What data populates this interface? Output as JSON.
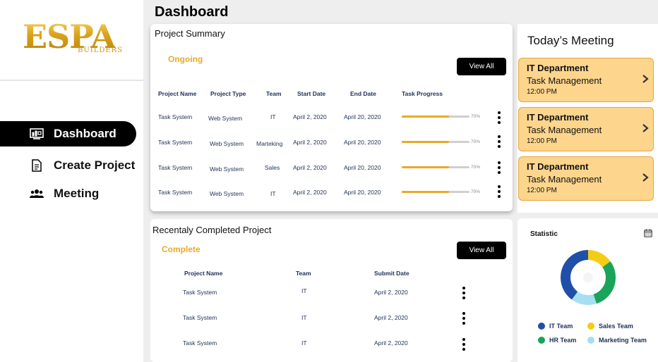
{
  "logo": {
    "main": "ESPA",
    "sub": "BUILDERS"
  },
  "nav": [
    {
      "label": "Dashboard",
      "active": true,
      "icon": "dashboard-icon"
    },
    {
      "label": "Create Project",
      "active": false,
      "icon": "document-icon"
    },
    {
      "label": "Meeting",
      "active": false,
      "icon": "people-icon"
    }
  ],
  "header": {
    "title": "Dashboard"
  },
  "summary": {
    "title": "Project Summary",
    "status": "Ongoing",
    "view_all": "View All",
    "columns": [
      "Project Name",
      "Project Type",
      "Team",
      "Start Date",
      "End Date",
      "Task Progress"
    ],
    "rows": [
      {
        "name": "Task System",
        "type": "Web System",
        "team": "IT",
        "start": "April 2, 2020",
        "end": "April 20, 2020",
        "progress": 0.7,
        "progress_label": "70%"
      },
      {
        "name": "Task System",
        "type": "Web System",
        "team": "Marteking",
        "start": "April 2, 2020",
        "end": "April 20, 2020",
        "progress": 0.7,
        "progress_label": "70%"
      },
      {
        "name": "Task System",
        "type": "Web System",
        "team": "Sales",
        "start": "April 2, 2020",
        "end": "April 20, 2020",
        "progress": 0.7,
        "progress_label": "70%"
      },
      {
        "name": "Task System",
        "type": "Web System",
        "team": "IT",
        "start": "April 2, 2020",
        "end": "April 20, 2020",
        "progress": 0.7,
        "progress_label": "70%"
      }
    ]
  },
  "completed": {
    "title": "Recentaly Completed Project",
    "status": "Complete",
    "view_all": "View All",
    "columns": [
      "Project Name",
      "Team",
      "Submit Date"
    ],
    "rows": [
      {
        "name": "Task System",
        "team": "IT",
        "date": "April 2, 2020"
      },
      {
        "name": "Task System",
        "team": "IT",
        "date": "April 2, 2020"
      },
      {
        "name": "Task System",
        "team": "IT",
        "date": "April 2, 2020"
      }
    ]
  },
  "meetings": {
    "title": "Today’s Meeting",
    "items": [
      {
        "dept": "IT Department",
        "task": "Task Management",
        "time": "12:00 PM"
      },
      {
        "dept": "IT Department",
        "task": "Task Management",
        "time": "12:00 PM"
      },
      {
        "dept": "IT Department",
        "task": "Task Management",
        "time": "12:00 PM"
      }
    ]
  },
  "statistic": {
    "title": "Statistic",
    "legend": [
      {
        "label": "IT Team",
        "color": "#1f4fa8"
      },
      {
        "label": "Sales Team",
        "color": "#f5cc14"
      },
      {
        "label": "HR Team",
        "color": "#1aa35b"
      },
      {
        "label": "Marketing Team",
        "color": "#a6def2"
      }
    ],
    "shares": [
      0.4,
      0.15,
      0.3,
      0.15
    ]
  },
  "colors": {
    "accent": "#e9a92a",
    "meeting_bg": "#fdd58c",
    "text_dark": "#1e2f55"
  }
}
